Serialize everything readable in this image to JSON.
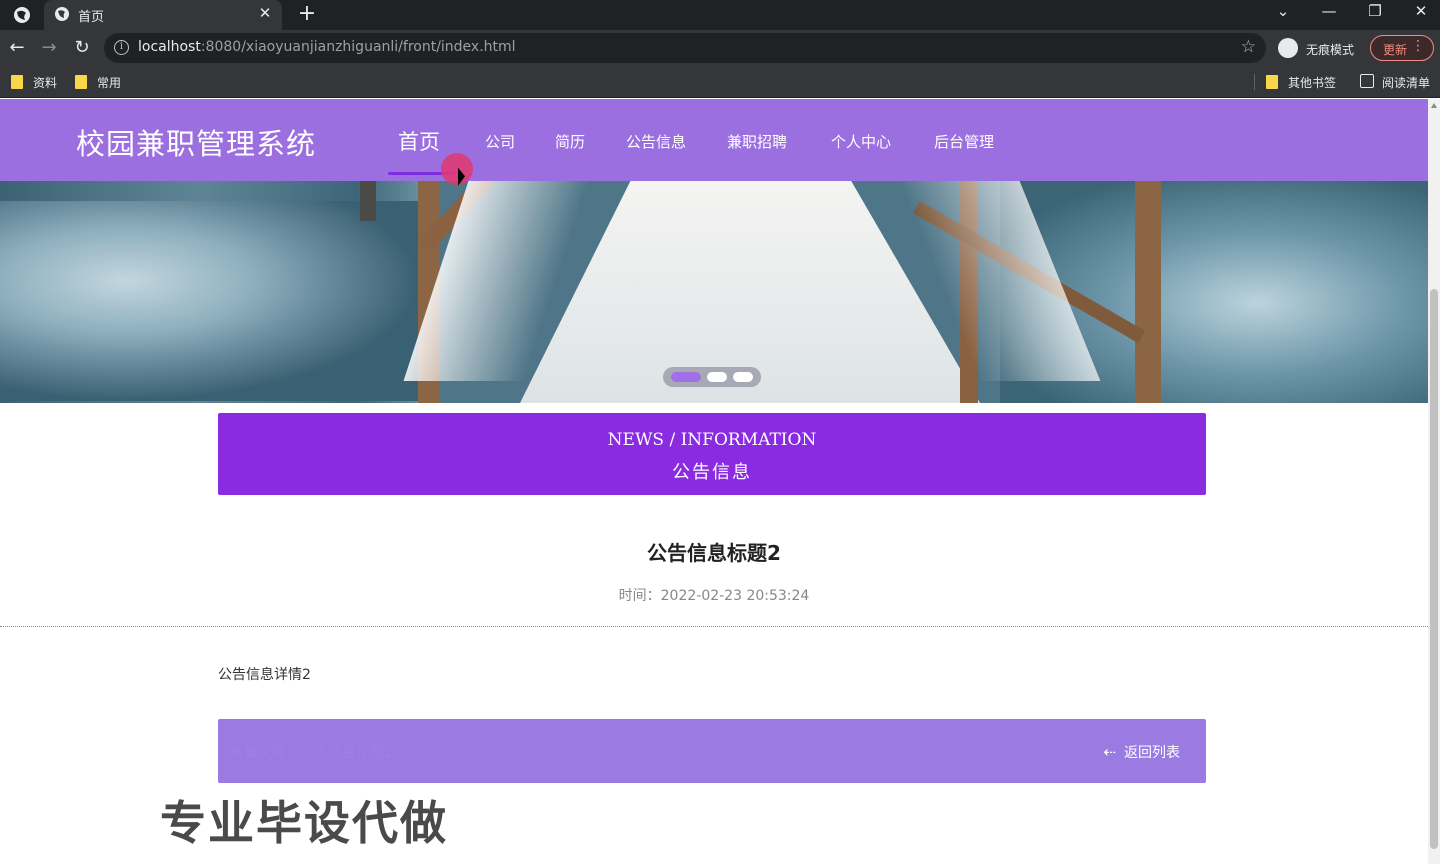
{
  "browser": {
    "tab_title": "首页",
    "tab_close": "✕",
    "new_tab": "+",
    "window_controls": [
      "⌄",
      "—",
      "❐",
      "✕"
    ],
    "url_host": "localhost",
    "url_rest": ":8080/xiaoyuanjianzhiguanli/front/index.html",
    "incognito_label": "无痕模式",
    "update_label": "更新",
    "bookmarks": [
      "资料",
      "常用",
      "其他书签",
      "阅读清单"
    ]
  },
  "site": {
    "title": "校园兼职管理系统",
    "nav": [
      "首页",
      "公司",
      "简历",
      "公告信息",
      "兼职招聘",
      "个人中心",
      "后台管理"
    ],
    "active_nav_index": 0,
    "carousel": {
      "slide_count": 3,
      "active_index": 0,
      "active_color": "#a070e8"
    }
  },
  "news_header": {
    "en": "NEWS / INFORMATION",
    "cn": "公告信息"
  },
  "article": {
    "title": "公告信息标题2",
    "time": "时间：2022-02-23 20:53:24",
    "body": "公告信息详情2",
    "current_label": "本篇文章：公告信息标题2",
    "back_label": "返回列表",
    "back_icon": "arrow-left-icon"
  },
  "watermark": "专业毕设代做",
  "colors": {
    "nav_bg": "#9b6fe0",
    "news_banner_bg": "#8a2be2",
    "bottom_bar_bg": "#9b7be2"
  }
}
